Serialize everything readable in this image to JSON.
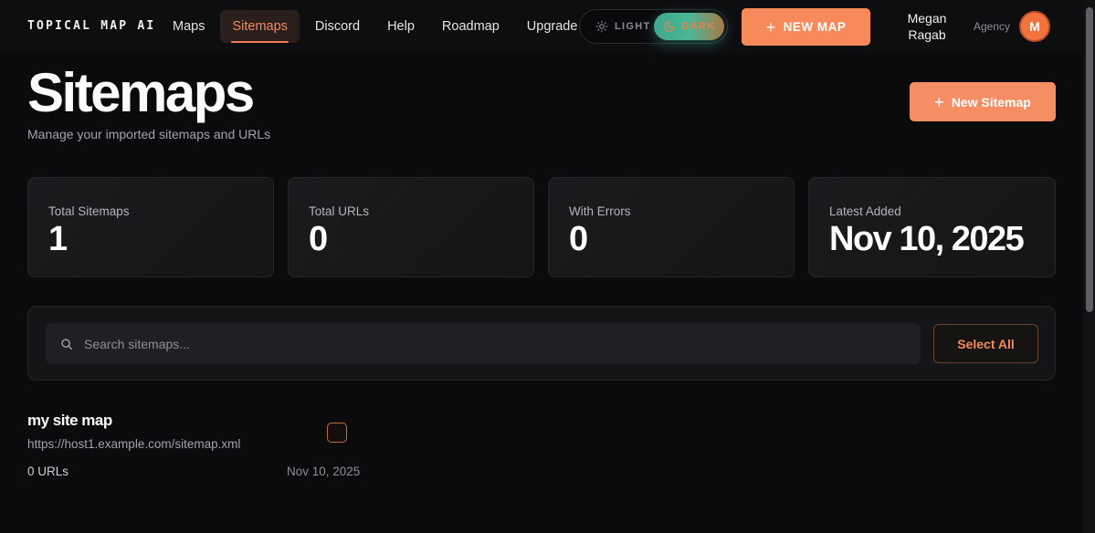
{
  "navbar": {
    "brand": "TOPICAL MAP AI",
    "links": [
      {
        "label": "Maps",
        "active": false
      },
      {
        "label": "Sitemaps",
        "active": true
      },
      {
        "label": "Discord",
        "active": false
      },
      {
        "label": "Help",
        "active": false
      },
      {
        "label": "Roadmap",
        "active": false
      },
      {
        "label": "Upgrade",
        "active": false
      }
    ],
    "theme": {
      "light_label": "LIGHT",
      "dark_label": "DARK",
      "selected": "dark"
    },
    "new_map_label": "NEW MAP",
    "user": {
      "first_name": "Megan",
      "last_name": "Ragab",
      "plan": "Agency",
      "avatar_initial": "M"
    }
  },
  "page": {
    "title": "Sitemaps",
    "subtitle": "Manage your imported sitemaps and URLs",
    "new_sitemap_label": "New Sitemap"
  },
  "stats": [
    {
      "label": "Total Sitemaps",
      "value": "1"
    },
    {
      "label": "Total URLs",
      "value": "0"
    },
    {
      "label": "With Errors",
      "value": "0"
    },
    {
      "label": "Latest Added",
      "value": "Nov 10, 2025"
    }
  ],
  "search": {
    "placeholder": "Search sitemaps...",
    "value": "",
    "select_all_label": "Select All"
  },
  "sitemaps": [
    {
      "name": "my site map",
      "url": "https://host1.example.com/sitemap.xml",
      "url_count": "0 URLs",
      "date": "Nov 10, 2025",
      "selected": false
    }
  ],
  "colors": {
    "accent": "#f7895a",
    "background": "#0b0b0d",
    "card": "#18181b",
    "toggle_teal": "#3fa88f"
  }
}
